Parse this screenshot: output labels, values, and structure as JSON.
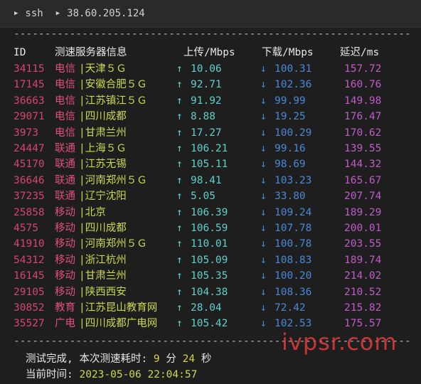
{
  "tab": {
    "item1": "ssh",
    "item2": "38.60.205.124"
  },
  "separator": "----------------------------------------------------------------------------",
  "header": {
    "id": "ID",
    "server": "测速服务器信息",
    "up": "上传/Mbps",
    "down": "下载/Mbps",
    "latency": "延迟/ms"
  },
  "rows": [
    {
      "id": "34115",
      "isp": "电信",
      "loc": "|天津５Ｇ",
      "up": "10.06",
      "down": "100.31",
      "lat": "157.72"
    },
    {
      "id": "17145",
      "isp": "电信",
      "loc": "|安徽合肥５Ｇ",
      "up": "92.71",
      "down": "102.36",
      "lat": "160.76"
    },
    {
      "id": "36663",
      "isp": "电信",
      "loc": "|江苏镇江５Ｇ",
      "up": "91.92",
      "down": "99.99",
      "lat": "149.98"
    },
    {
      "id": "29071",
      "isp": "电信",
      "loc": "|四川成都",
      "up": "8.88",
      "down": "19.25",
      "lat": "176.47"
    },
    {
      "id": "3973",
      "isp": "电信",
      "loc": "|甘肃兰州",
      "up": "17.27",
      "down": "100.29",
      "lat": "170.62"
    },
    {
      "id": "24447",
      "isp": "联通",
      "loc": "|上海５Ｇ",
      "up": "106.21",
      "down": "99.16",
      "lat": "139.55"
    },
    {
      "id": "45170",
      "isp": "联通",
      "loc": "|江苏无锡",
      "up": "105.11",
      "down": "98.69",
      "lat": "144.32"
    },
    {
      "id": "36646",
      "isp": "联通",
      "loc": "|河南郑州５Ｇ",
      "up": "98.41",
      "down": "103.23",
      "lat": "165.67"
    },
    {
      "id": "37235",
      "isp": "联通",
      "loc": "|辽宁沈阳",
      "up": "5.05",
      "down": "33.80",
      "lat": "207.74"
    },
    {
      "id": "25858",
      "isp": "移动",
      "loc": "|北京",
      "up": "106.39",
      "down": "109.24",
      "lat": "189.29"
    },
    {
      "id": "4575",
      "isp": "移动",
      "loc": "|四川成都",
      "up": "106.59",
      "down": "107.78",
      "lat": "200.01"
    },
    {
      "id": "41910",
      "isp": "移动",
      "loc": "|河南郑州５Ｇ",
      "up": "110.01",
      "down": "100.78",
      "lat": "203.55"
    },
    {
      "id": "54312",
      "isp": "移动",
      "loc": "|浙江杭州",
      "up": "105.09",
      "down": "108.83",
      "lat": "189.74"
    },
    {
      "id": "16145",
      "isp": "移动",
      "loc": "|甘肃兰州",
      "up": "105.35",
      "down": "100.20",
      "lat": "214.02"
    },
    {
      "id": "29105",
      "isp": "移动",
      "loc": "|陕西西安",
      "up": "104.38",
      "down": "108.36",
      "lat": "210.52"
    },
    {
      "id": "30852",
      "isp": "教育",
      "loc": "|江苏昆山教育网",
      "up": "28.04",
      "down": "72.42",
      "lat": "215.82"
    },
    {
      "id": "35527",
      "isp": "广电",
      "loc": "|四川成都广电网",
      "up": "105.42",
      "down": "102.53",
      "lat": "175.57"
    }
  ],
  "arrows": {
    "up": "↑",
    "down": "↓"
  },
  "footer": {
    "done_prefix": "测试完成, 本次测速耗时: ",
    "minutes": "9",
    "min_unit": " 分 ",
    "seconds": "24",
    "sec_unit": " 秒",
    "time_label": "当前时间: ",
    "time_value": "2023-05-06 22:04:57"
  },
  "watermark": "ivpsr.com"
}
